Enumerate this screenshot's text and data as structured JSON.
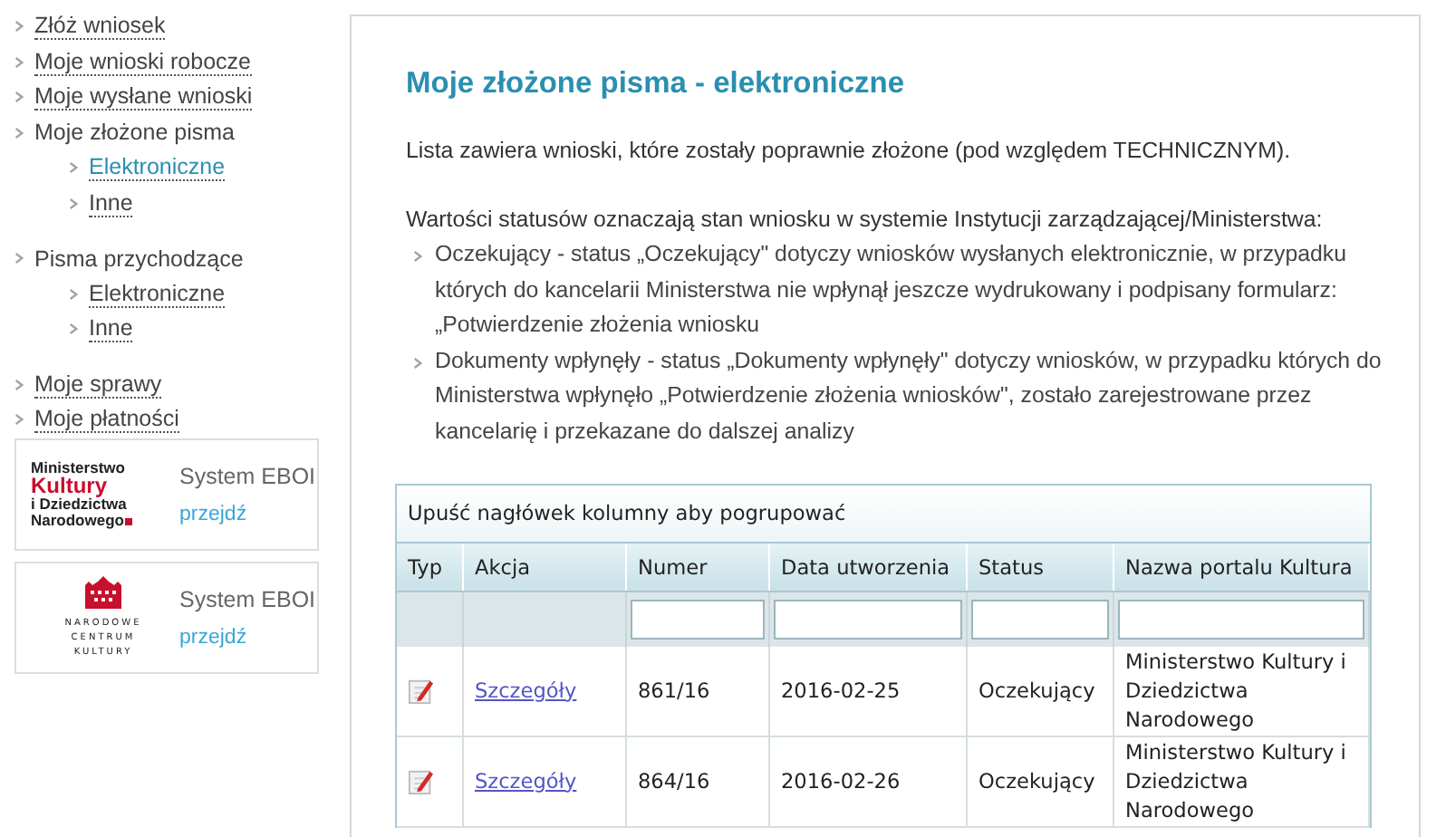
{
  "sidebar": {
    "groups": [
      [
        {
          "label": "Złóż wniosek",
          "selected": false,
          "link": true
        },
        {
          "label": "Moje wnioski robocze",
          "selected": false,
          "link": true
        },
        {
          "label": "Moje wysłane wnioski",
          "selected": false,
          "link": true
        },
        {
          "label": "Moje złożone pisma",
          "selected": false,
          "link": false,
          "children": [
            {
              "label": "Elektroniczne",
              "selected": true,
              "link": true
            },
            {
              "label": "Inne",
              "selected": false,
              "link": true
            }
          ]
        }
      ],
      [
        {
          "label": "Pisma przychodzące",
          "selected": false,
          "link": false,
          "children": [
            {
              "label": "Elektroniczne",
              "selected": false,
              "link": true
            },
            {
              "label": "Inne",
              "selected": false,
              "link": true
            }
          ]
        }
      ],
      [
        {
          "label": "Moje sprawy",
          "selected": false,
          "link": true
        },
        {
          "label": "Moje płatności",
          "selected": false,
          "link": true
        }
      ]
    ]
  },
  "banners": [
    {
      "kind": "ministry",
      "logo_lines": [
        {
          "text": "Ministerstwo",
          "highlight": false
        },
        {
          "text": "Kultury",
          "highlight": true
        },
        {
          "text": "i Dziedzictwa",
          "highlight": false
        },
        {
          "text": "Narodowego",
          "highlight": false
        }
      ],
      "title": "System EBOI",
      "link": "przejdź"
    },
    {
      "kind": "centre",
      "logo_lines": [
        {
          "text": "NARODOWE",
          "highlight": false
        },
        {
          "text": "CENTRUM",
          "highlight": false
        },
        {
          "text": "KULTURY",
          "highlight": false
        }
      ],
      "title": "System EBOI",
      "link": "przejdź"
    }
  ],
  "main": {
    "title": "Moje złożone pisma - elektroniczne",
    "intro": "Lista zawiera wnioski, które zostały poprawnie złożone (pod względem TECHNICZNYM).",
    "statuses_lead": "Wartości statusów oznaczają stan wniosku w systemie Instytucji zarządzającej/Ministerstwa:",
    "statuses": [
      "Oczekujący - status „Oczekujący\" dotyczy wniosków wysłanych elektronicznie, w przypadku których do kancelarii Ministerstwa nie wpłynął jeszcze wydrukowany i podpisany formularz: „Potwierdzenie złożenia wniosku",
      "Dokumenty wpłynęły - status „Dokumenty wpłynęły\" dotyczy wniosków, w przypadku których do Ministerstwa wpłynęło „Potwierdzenie złożenia wniosków\", zostało zarejestrowane przez kancelarię i przekazane do dalszej analizy"
    ]
  },
  "table": {
    "group_hint": "Upuść nagłówek kolumny aby pogrupować",
    "columns": [
      {
        "label": "Typ",
        "filter": false
      },
      {
        "label": "Akcja",
        "filter": false
      },
      {
        "label": "Numer",
        "filter": true
      },
      {
        "label": "Data utworzenia",
        "filter": true
      },
      {
        "label": "Status",
        "filter": true
      },
      {
        "label": "Nazwa portalu Kultura",
        "filter": true
      }
    ],
    "rows": [
      {
        "action": "Szczegóły",
        "number": "861/16",
        "created": "2016-02-25",
        "status": "Oczekujący",
        "portal": "Ministerstwo Kultury i Dziedzictwa Narodowego"
      },
      {
        "action": "Szczegóły",
        "number": "864/16",
        "created": "2016-02-26",
        "status": "Oczekujący",
        "portal": "Ministerstwo Kultury i Dziedzictwa Narodowego"
      }
    ]
  }
}
